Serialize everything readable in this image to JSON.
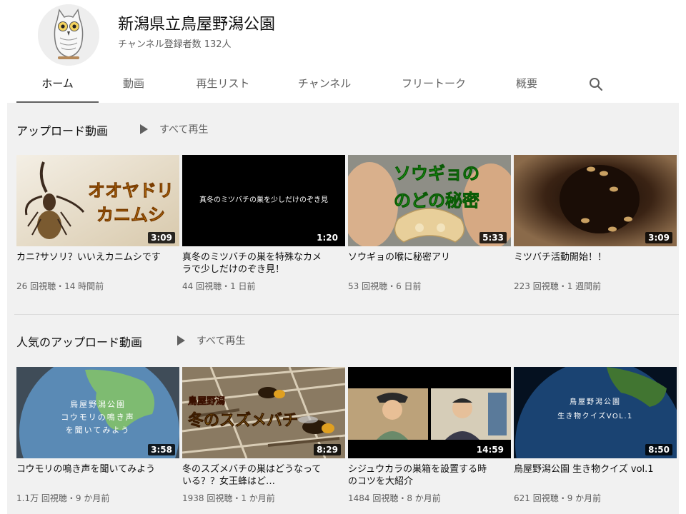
{
  "channel": {
    "name": "新潟県立鳥屋野潟公園",
    "subscribers": "チャンネル登録者数 132人",
    "avatar_icon": "owl-icon"
  },
  "tabs": [
    {
      "label": "ホーム",
      "active": true
    },
    {
      "label": "動画"
    },
    {
      "label": "再生リスト"
    },
    {
      "label": "チャンネル"
    },
    {
      "label": "フリートーク"
    },
    {
      "label": "概要"
    }
  ],
  "search_icon": "search-icon",
  "sections": [
    {
      "title": "アップロード動画",
      "play_all": "すべて再生",
      "videos": [
        {
          "title": "カニ?サソリ？いいえカニムシです",
          "meta": "26 回視聴・14 時間前",
          "duration": "3:09",
          "thumb_text": [
            "オオヤドリ",
            "カニムシ"
          ]
        },
        {
          "title": "真冬のミツバチの巣を特殊なカメラで少しだけのぞき見！",
          "meta": "44 回視聴・1 日前",
          "duration": "1:20",
          "thumb_text": [
            "真冬のミツバチの巣を少しだけのぞき見"
          ]
        },
        {
          "title": "ソウギョの喉に秘密アリ",
          "meta": "53 回視聴・6 日前",
          "duration": "5:33",
          "thumb_text": [
            "ソウギョの",
            "のどの秘密"
          ]
        },
        {
          "title": "ミツバチ活動開始！！",
          "meta": "223 回視聴・1 週間前",
          "duration": "3:09",
          "thumb_text": []
        }
      ]
    },
    {
      "title": "人気のアップロード動画",
      "play_all": "すべて再生",
      "videos": [
        {
          "title": "コウモリの鳴き声を聞いてみよう",
          "meta": "1.1万 回視聴・9 か月前",
          "duration": "3:58",
          "thumb_text": [
            "鳥屋野潟公園",
            "コウモリの鳴き声",
            "を聞いてみよう"
          ]
        },
        {
          "title": "冬のスズメバチの巣はどうなっている？？女王蜂はど…",
          "meta": "1938 回視聴・1 か月前",
          "duration": "8:29",
          "thumb_text": [
            "鳥屋野潟",
            "冬のスズメバチ"
          ]
        },
        {
          "title": "シジュウカラの巣箱を設置する時のコツを大紹介",
          "meta": "1484 回視聴・8 か月前",
          "duration": "14:59",
          "thumb_text": []
        },
        {
          "title": "鳥屋野潟公園 生き物クイズ vol.1",
          "meta": "621 回視聴・9 か月前",
          "duration": "8:50",
          "thumb_text": [
            "鳥屋野潟公園",
            "生き物クイズVOL.1"
          ]
        }
      ]
    }
  ]
}
